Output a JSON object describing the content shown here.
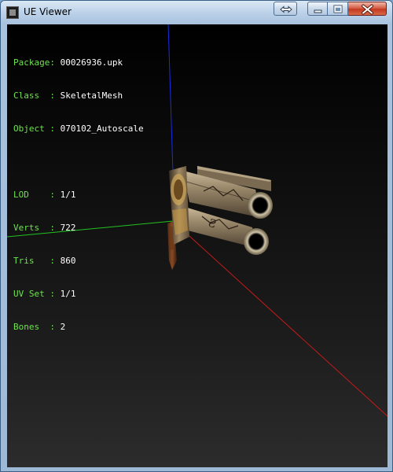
{
  "window": {
    "title": "UE Viewer",
    "icon": "app-icon"
  },
  "caption_buttons": {
    "swap": "swap-arrows-icon",
    "minimize": "minimize-icon",
    "maximize": "maximize-icon",
    "close": "close-icon"
  },
  "info": {
    "package_key": "Package: ",
    "package_val": "00026936.upk",
    "class_key": "Class  : ",
    "class_val": "SkeletalMesh",
    "object_key": "Object : ",
    "object_val": "070102_Autoscale",
    "lod_key": "LOD    : ",
    "lod_val": "1/1",
    "verts_key": "Verts  : ",
    "verts_val": "722",
    "tris_key": "Tris   : ",
    "tris_val": "860",
    "uvset_key": "UV Set : ",
    "uvset_val": "1/1",
    "bones_key": "Bones  : ",
    "bones_val": "2"
  },
  "colors": {
    "label_green": "#6fe34f",
    "axis_x": "#c81a1a",
    "axis_y": "#22c322",
    "axis_z": "#1a2ee0",
    "background": "#000000"
  }
}
